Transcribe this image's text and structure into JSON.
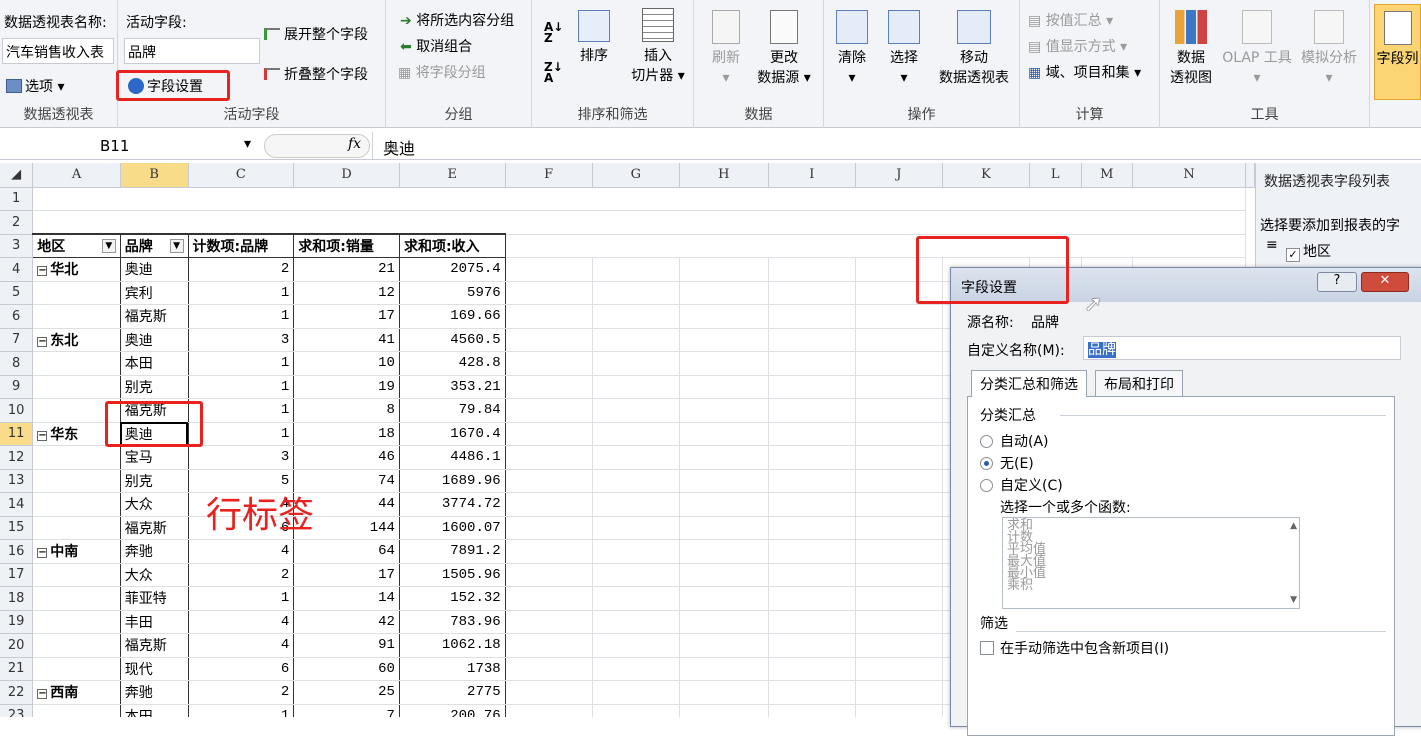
{
  "ribbon": {
    "pivot_name_label": "数据透视表名称:",
    "pivot_name_value": "汽车销售收入表",
    "options_label": "选项",
    "group_pivot_label": "数据透视表",
    "active_field_label": "活动字段:",
    "active_field_value": "品牌",
    "field_settings_label": "字段设置",
    "expand_label": "展开整个字段",
    "collapse_label": "折叠整个字段",
    "group_active_label": "活动字段",
    "group_selection_label": "将所选内容分组",
    "ungroup_label": "取消组合",
    "group_field_label": "将字段分组",
    "group_group_label": "分组",
    "sort_label": "排序",
    "insert_slicer_label1": "插入",
    "insert_slicer_label2": "切片器",
    "group_sort_label": "排序和筛选",
    "refresh_label": "刷新",
    "change_source_label1": "更改",
    "change_source_label2": "数据源",
    "group_data_label": "数据",
    "clear_label": "清除",
    "select_label": "选择",
    "move_label1": "移动",
    "move_label2": "数据透视表",
    "group_actions_label": "操作",
    "summarize_label": "按值汇总",
    "show_values_label": "值显示方式",
    "fields_items_label": "域、项目和集",
    "group_calc_label": "计算",
    "pivotchart_label1": "数据",
    "pivotchart_label2": "透视图",
    "olap_label": "OLAP 工具",
    "whatif_label": "模拟分析",
    "group_tools_label": "工具",
    "field_list_label": "字段列"
  },
  "formula_bar": {
    "cell_ref": "B11",
    "fx": "fx",
    "value": "奥迪"
  },
  "columns": [
    "A",
    "B",
    "C",
    "D",
    "E",
    "F",
    "G",
    "H",
    "I",
    "J",
    "K",
    "L",
    "M",
    "N"
  ],
  "headers": {
    "a": "地区",
    "b": "品牌",
    "c": "计数项:品牌",
    "d": "求和项:销量",
    "e": "求和项:收入"
  },
  "rows": [
    {
      "n": "4",
      "region": "华北",
      "brand": "奥迪",
      "count": "2",
      "sales": "21",
      "rev": "2075.4"
    },
    {
      "n": "5",
      "region": "",
      "brand": "宾利",
      "count": "1",
      "sales": "12",
      "rev": "5976"
    },
    {
      "n": "6",
      "region": "",
      "brand": "福克斯",
      "count": "1",
      "sales": "17",
      "rev": "169.66"
    },
    {
      "n": "7",
      "region": "东北",
      "brand": "奥迪",
      "count": "3",
      "sales": "41",
      "rev": "4560.5"
    },
    {
      "n": "8",
      "region": "",
      "brand": "本田",
      "count": "1",
      "sales": "10",
      "rev": "428.8"
    },
    {
      "n": "9",
      "region": "",
      "brand": "别克",
      "count": "1",
      "sales": "19",
      "rev": "353.21"
    },
    {
      "n": "10",
      "region": "",
      "brand": "福克斯",
      "count": "1",
      "sales": "8",
      "rev": "79.84"
    },
    {
      "n": "11",
      "region": "华东",
      "brand": "奥迪",
      "count": "1",
      "sales": "18",
      "rev": "1670.4"
    },
    {
      "n": "12",
      "region": "",
      "brand": "宝马",
      "count": "3",
      "sales": "46",
      "rev": "4486.1"
    },
    {
      "n": "13",
      "region": "",
      "brand": "别克",
      "count": "5",
      "sales": "74",
      "rev": "1689.96"
    },
    {
      "n": "14",
      "region": "",
      "brand": "大众",
      "count": "4",
      "sales": "44",
      "rev": "3774.72"
    },
    {
      "n": "15",
      "region": "",
      "brand": "福克斯",
      "count": "6",
      "sales": "144",
      "rev": "1600.07"
    },
    {
      "n": "16",
      "region": "中南",
      "brand": "奔驰",
      "count": "4",
      "sales": "64",
      "rev": "7891.2"
    },
    {
      "n": "17",
      "region": "",
      "brand": "大众",
      "count": "2",
      "sales": "17",
      "rev": "1505.96"
    },
    {
      "n": "18",
      "region": "",
      "brand": "菲亚特",
      "count": "1",
      "sales": "14",
      "rev": "152.32"
    },
    {
      "n": "19",
      "region": "",
      "brand": "丰田",
      "count": "4",
      "sales": "42",
      "rev": "783.96"
    },
    {
      "n": "20",
      "region": "",
      "brand": "福克斯",
      "count": "4",
      "sales": "91",
      "rev": "1062.18"
    },
    {
      "n": "21",
      "region": "",
      "brand": "现代",
      "count": "6",
      "sales": "60",
      "rev": "1738"
    },
    {
      "n": "22",
      "region": "西南",
      "brand": "奔驰",
      "count": "2",
      "sales": "25",
      "rev": "2775"
    },
    {
      "n": "23",
      "region": "",
      "brand": "本田",
      "count": "1",
      "sales": "7",
      "rev": "200.76"
    }
  ],
  "annotation": "行标签",
  "panel": {
    "title": "数据透视表字段列表",
    "choose": "选择要添加到报表的字",
    "field1": "地区"
  },
  "dialog": {
    "title": "字段设置",
    "source_label": "源名称:",
    "source_value": "品牌",
    "custom_label": "自定义名称(M):",
    "custom_value": "品牌",
    "tab1": "分类汇总和筛选",
    "tab2": "布局和打印",
    "subtotal_section": "分类汇总",
    "opt_auto": "自动(A)",
    "opt_none": "无(E)",
    "opt_custom": "自定义(C)",
    "choose_funcs": "选择一个或多个函数:",
    "funcs": [
      "求和",
      "计数",
      "平均值",
      "最大值",
      "最小值",
      "乘积"
    ],
    "filter_section": "筛选",
    "include_new": "在手动筛选中包含新项目(I)",
    "help": "?",
    "close": "✕"
  },
  "colors": {
    "accent_red": "#e8231f",
    "selected_col": "#f9dc8a"
  }
}
